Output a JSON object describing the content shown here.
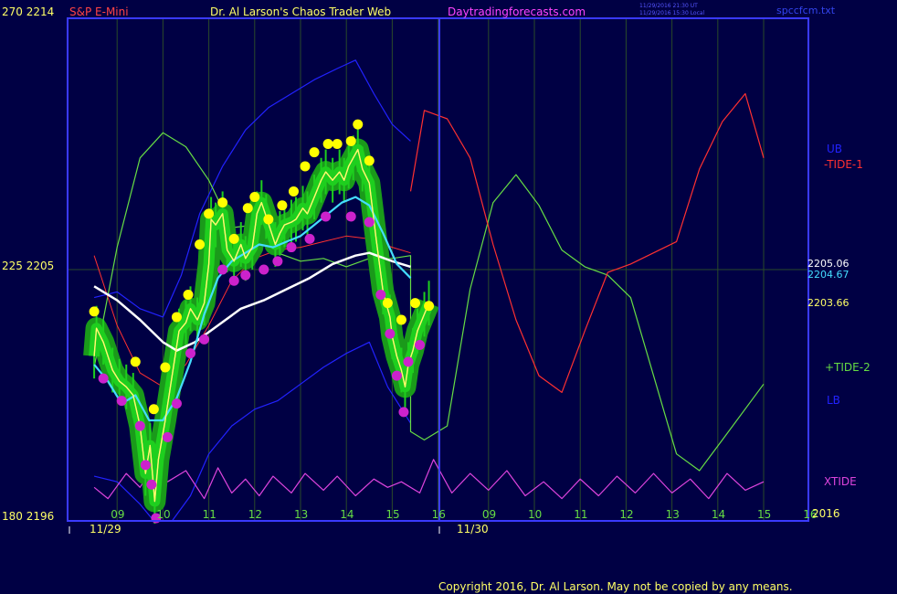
{
  "header": {
    "symbol": "S&P E-Mini",
    "title": "Dr. Al Larson's Chaos Trader Web",
    "site": "Daytradingforecasts.com",
    "timestamp_utc": "11/29/2016 21:30 UT",
    "timestamp_local": "11/29/2016 15:30 Local",
    "filename": "spccfcm.txt"
  },
  "axis": {
    "left_top": "270  2214",
    "left_mid": "225  2205",
    "left_bottom": "180  2196",
    "date1": "11/29",
    "date2": "11/30",
    "year": "2016",
    "hour_ticks": [
      "09",
      "10",
      "11",
      "12",
      "13",
      "14",
      "15",
      "16",
      "09",
      "10",
      "11",
      "12",
      "13",
      "14",
      "15",
      "16"
    ]
  },
  "price_labels": {
    "p1": "2205.06",
    "p2": "2204.67",
    "p3": "2203.66"
  },
  "legend": {
    "ub": "UB",
    "tide1": "-TIDE-1",
    "tide2": "+TIDE-2",
    "lb": "LB",
    "xtide": "XTIDE"
  },
  "copyright": "Copyright 2016, Dr. Al Larson. May not be copied by any means.",
  "colors": {
    "background": "#000044",
    "frame": "#3a3aff",
    "grid": "#2a4a2a",
    "tick_text": "#ffff66",
    "symbol": "#ff4444",
    "title": "#ffff66",
    "site": "#ff44ff",
    "price_bar": "#1ecf1e",
    "glow": "#1a9a1a",
    "high_dot": "#ffff00",
    "low_dot": "#cc22cc",
    "close_line": "#ffff66",
    "fast_avg": "#ff66ff",
    "cyan_avg": "#44ddff",
    "white_avg": "#ffffff",
    "tide1": "#ff3030",
    "tide2": "#66dd44",
    "bands": "#2222ff",
    "xtide": "#dd44dd"
  },
  "chart_data": {
    "type": "line",
    "title": "Dr. Al Larson's Chaos Trader Web",
    "ylim": [
      2196,
      2214
    ],
    "y_ticks": [
      2196,
      2205,
      2214
    ],
    "x_hours": [
      8.5,
      17.5
    ],
    "price_close": [
      [
        8.5,
        2201.9
      ],
      [
        8.55,
        2202.9
      ],
      [
        8.7,
        2202.4
      ],
      [
        8.9,
        2201.4
      ],
      [
        9.05,
        2201.0
      ],
      [
        9.2,
        2200.8
      ],
      [
        9.35,
        2200.5
      ],
      [
        9.5,
        2199.4
      ],
      [
        9.62,
        2197.7
      ],
      [
        9.72,
        2198.7
      ],
      [
        9.82,
        2196.7
      ],
      [
        9.9,
        2198.2
      ],
      [
        10.05,
        2199.6
      ],
      [
        10.2,
        2201.2
      ],
      [
        10.35,
        2202.8
      ],
      [
        10.5,
        2203.1
      ],
      [
        10.6,
        2203.6
      ],
      [
        10.75,
        2203.2
      ],
      [
        10.9,
        2203.8
      ],
      [
        11.0,
        2205.2
      ],
      [
        11.05,
        2206.8
      ],
      [
        11.15,
        2206.6
      ],
      [
        11.3,
        2207.0
      ],
      [
        11.4,
        2205.7
      ],
      [
        11.55,
        2205.3
      ],
      [
        11.7,
        2205.9
      ],
      [
        11.8,
        2205.4
      ],
      [
        11.95,
        2205.8
      ],
      [
        12.05,
        2207.0
      ],
      [
        12.15,
        2207.4
      ],
      [
        12.25,
        2206.9
      ],
      [
        12.45,
        2205.9
      ],
      [
        12.55,
        2206.3
      ],
      [
        12.65,
        2206.6
      ],
      [
        12.8,
        2206.7
      ],
      [
        12.9,
        2206.8
      ],
      [
        13.05,
        2207.2
      ],
      [
        13.15,
        2207.0
      ],
      [
        13.3,
        2207.6
      ],
      [
        13.45,
        2208.2
      ],
      [
        13.55,
        2208.5
      ],
      [
        13.7,
        2208.2
      ],
      [
        13.85,
        2208.5
      ],
      [
        13.95,
        2208.2
      ],
      [
        14.05,
        2208.7
      ],
      [
        14.15,
        2209.0
      ],
      [
        14.25,
        2209.3
      ],
      [
        14.35,
        2208.6
      ],
      [
        14.5,
        2208.1
      ],
      [
        14.65,
        2206.1
      ],
      [
        14.8,
        2204.2
      ],
      [
        14.95,
        2203.3
      ],
      [
        15.0,
        2202.6
      ],
      [
        15.1,
        2201.9
      ],
      [
        15.2,
        2201.4
      ],
      [
        15.28,
        2200.8
      ],
      [
        15.35,
        2201.6
      ],
      [
        15.45,
        2202.1
      ],
      [
        15.55,
        2202.8
      ],
      [
        15.7,
        2203.4
      ],
      [
        15.8,
        2203.8
      ]
    ],
    "highs": [
      [
        8.5,
        2203.5
      ],
      [
        9.4,
        2201.7
      ],
      [
        9.8,
        2200.0
      ],
      [
        10.05,
        2201.5
      ],
      [
        10.3,
        2203.3
      ],
      [
        10.55,
        2204.1
      ],
      [
        10.8,
        2205.9
      ],
      [
        11.0,
        2207.0
      ],
      [
        11.3,
        2207.4
      ],
      [
        11.55,
        2206.1
      ],
      [
        11.85,
        2207.2
      ],
      [
        12.0,
        2207.6
      ],
      [
        12.3,
        2206.8
      ],
      [
        12.6,
        2207.3
      ],
      [
        12.85,
        2207.8
      ],
      [
        13.1,
        2208.7
      ],
      [
        13.3,
        2209.2
      ],
      [
        13.6,
        2209.5
      ],
      [
        13.8,
        2209.5
      ],
      [
        14.1,
        2209.6
      ],
      [
        14.25,
        2210.2
      ],
      [
        14.5,
        2208.9
      ],
      [
        14.9,
        2203.8
      ],
      [
        15.2,
        2203.2
      ],
      [
        15.5,
        2203.8
      ],
      [
        15.8,
        2203.7
      ]
    ],
    "lows": [
      [
        8.7,
        2201.1
      ],
      [
        9.1,
        2200.3
      ],
      [
        9.5,
        2199.4
      ],
      [
        9.62,
        2198.0
      ],
      [
        9.75,
        2197.3
      ],
      [
        9.85,
        2196.1
      ],
      [
        10.1,
        2199.0
      ],
      [
        10.3,
        2200.2
      ],
      [
        10.6,
        2202.0
      ],
      [
        10.9,
        2202.5
      ],
      [
        11.3,
        2205.0
      ],
      [
        11.55,
        2204.6
      ],
      [
        11.8,
        2204.8
      ],
      [
        12.2,
        2205.0
      ],
      [
        12.5,
        2205.3
      ],
      [
        12.8,
        2205.8
      ],
      [
        13.2,
        2206.1
      ],
      [
        13.55,
        2206.9
      ],
      [
        14.1,
        2206.9
      ],
      [
        14.5,
        2206.7
      ],
      [
        14.75,
        2204.1
      ],
      [
        14.95,
        2202.7
      ],
      [
        15.1,
        2201.2
      ],
      [
        15.25,
        2199.9
      ],
      [
        15.35,
        2201.7
      ],
      [
        15.6,
        2202.3
      ]
    ],
    "series": [
      {
        "name": "UB",
        "values": [
          [
            8.5,
            2204.0
          ],
          [
            9.0,
            2204.2
          ],
          [
            9.5,
            2203.6
          ],
          [
            10.0,
            2203.3
          ],
          [
            10.4,
            2204.8
          ],
          [
            10.8,
            2207.0
          ],
          [
            11.3,
            2208.7
          ],
          [
            11.8,
            2210.0
          ],
          [
            12.3,
            2210.8
          ],
          [
            12.8,
            2211.3
          ],
          [
            13.3,
            2211.8
          ],
          [
            13.8,
            2212.2
          ],
          [
            14.2,
            2212.5
          ],
          [
            14.6,
            2211.3
          ],
          [
            15.0,
            2210.2
          ],
          [
            15.4,
            2209.6
          ]
        ]
      },
      {
        "name": "LB",
        "values": [
          [
            8.5,
            2197.6
          ],
          [
            9.0,
            2197.4
          ],
          [
            9.5,
            2196.6
          ],
          [
            9.8,
            2196.0
          ],
          [
            10.2,
            2196.0
          ],
          [
            10.6,
            2196.9
          ],
          [
            11.0,
            2198.4
          ],
          [
            11.5,
            2199.4
          ],
          [
            12.0,
            2200.0
          ],
          [
            12.5,
            2200.3
          ],
          [
            13.0,
            2200.9
          ],
          [
            13.5,
            2201.5
          ],
          [
            14.0,
            2202.0
          ],
          [
            14.5,
            2202.4
          ],
          [
            14.9,
            2200.8
          ],
          [
            15.4,
            2199.5
          ]
        ]
      },
      {
        "name": "-TIDE-1",
        "values": [
          [
            15.4,
            2207.8
          ],
          [
            15.7,
            2210.7
          ],
          [
            16.2,
            2210.4
          ],
          [
            16.7,
            2209.0
          ],
          [
            17.2,
            2205.9
          ],
          [
            17.7,
            2203.2
          ],
          [
            18.2,
            2201.2
          ],
          [
            18.7,
            2200.6
          ],
          [
            19.2,
            2202.8
          ],
          [
            19.7,
            2204.9
          ],
          [
            20.2,
            2205.2
          ],
          [
            20.7,
            2205.6
          ],
          [
            21.2,
            2206.0
          ],
          [
            21.7,
            2208.6
          ],
          [
            22.2,
            2210.3
          ],
          [
            22.7,
            2211.3
          ],
          [
            23.1,
            2209.0
          ]
        ]
      },
      {
        "name": "+TIDE-2",
        "values": [
          [
            8.5,
            2201.5
          ],
          [
            9.0,
            2205.8
          ],
          [
            9.5,
            2209.0
          ],
          [
            10.0,
            2209.9
          ],
          [
            10.5,
            2209.4
          ],
          [
            11.0,
            2208.2
          ],
          [
            11.5,
            2206.5
          ],
          [
            12.0,
            2206.6
          ],
          [
            12.5,
            2205.6
          ],
          [
            13.0,
            2205.3
          ],
          [
            13.5,
            2205.4
          ],
          [
            14.0,
            2205.1
          ],
          [
            14.5,
            2205.4
          ],
          [
            15.0,
            2205.4
          ],
          [
            15.4,
            2205.5
          ],
          [
            15.4,
            2199.2
          ],
          [
            15.7,
            2198.9
          ],
          [
            16.2,
            2199.4
          ],
          [
            16.7,
            2204.3
          ],
          [
            17.2,
            2207.4
          ],
          [
            17.7,
            2208.4
          ],
          [
            18.2,
            2207.3
          ],
          [
            18.7,
            2205.7
          ],
          [
            19.2,
            2205.1
          ],
          [
            19.7,
            2204.8
          ],
          [
            20.2,
            2204.0
          ],
          [
            20.7,
            2201.2
          ],
          [
            21.2,
            2198.4
          ],
          [
            21.7,
            2197.8
          ],
          [
            22.2,
            2198.9
          ],
          [
            23.1,
            2200.9
          ]
        ]
      },
      {
        "name": "XTIDE",
        "values": [
          [
            8.5,
            2197.2
          ],
          [
            8.8,
            2196.8
          ],
          [
            9.2,
            2197.7
          ],
          [
            9.5,
            2197.2
          ],
          [
            9.8,
            2198.0
          ],
          [
            10.1,
            2197.4
          ],
          [
            10.5,
            2197.8
          ],
          [
            10.9,
            2196.8
          ],
          [
            11.2,
            2197.9
          ],
          [
            11.5,
            2197.0
          ],
          [
            11.8,
            2197.5
          ],
          [
            12.1,
            2196.9
          ],
          [
            12.4,
            2197.6
          ],
          [
            12.8,
            2197.0
          ],
          [
            13.1,
            2197.7
          ],
          [
            13.5,
            2197.1
          ],
          [
            13.8,
            2197.6
          ],
          [
            14.2,
            2196.9
          ],
          [
            14.6,
            2197.5
          ],
          [
            14.9,
            2197.2
          ],
          [
            15.2,
            2197.4
          ],
          [
            15.6,
            2197.0
          ],
          [
            15.9,
            2198.2
          ],
          [
            16.3,
            2197.0
          ],
          [
            16.7,
            2197.7
          ],
          [
            17.1,
            2197.1
          ],
          [
            17.5,
            2197.8
          ],
          [
            17.9,
            2196.9
          ],
          [
            18.3,
            2197.4
          ],
          [
            18.7,
            2196.8
          ],
          [
            19.1,
            2197.5
          ],
          [
            19.5,
            2196.9
          ],
          [
            19.9,
            2197.6
          ],
          [
            20.3,
            2197.0
          ],
          [
            20.7,
            2197.7
          ],
          [
            21.1,
            2197.0
          ],
          [
            21.5,
            2197.5
          ],
          [
            21.9,
            2196.8
          ],
          [
            22.3,
            2197.7
          ],
          [
            22.7,
            2197.1
          ],
          [
            23.1,
            2197.4
          ]
        ]
      },
      {
        "name": "cyan_avg",
        "values": [
          [
            8.5,
            2201.6
          ],
          [
            8.8,
            2201.0
          ],
          [
            9.1,
            2200.2
          ],
          [
            9.4,
            2200.5
          ],
          [
            9.7,
            2199.6
          ],
          [
            10.0,
            2199.6
          ],
          [
            10.3,
            2200.4
          ],
          [
            10.6,
            2201.7
          ],
          [
            10.9,
            2203.4
          ],
          [
            11.2,
            2204.7
          ],
          [
            11.5,
            2205.3
          ],
          [
            11.8,
            2205.6
          ],
          [
            12.1,
            2205.9
          ],
          [
            12.4,
            2205.8
          ],
          [
            12.7,
            2206.0
          ],
          [
            13.0,
            2206.2
          ],
          [
            13.3,
            2206.6
          ],
          [
            13.6,
            2207.0
          ],
          [
            13.9,
            2207.4
          ],
          [
            14.2,
            2207.6
          ],
          [
            14.5,
            2207.3
          ],
          [
            14.8,
            2206.3
          ],
          [
            15.1,
            2205.2
          ],
          [
            15.4,
            2204.7
          ]
        ]
      },
      {
        "name": "white_avg",
        "values": [
          [
            8.5,
            2204.4
          ],
          [
            9.0,
            2203.9
          ],
          [
            9.5,
            2203.2
          ],
          [
            10.0,
            2202.4
          ],
          [
            10.3,
            2202.1
          ],
          [
            10.7,
            2202.4
          ],
          [
            11.2,
            2203.0
          ],
          [
            11.7,
            2203.6
          ],
          [
            12.2,
            2203.9
          ],
          [
            12.7,
            2204.3
          ],
          [
            13.2,
            2204.7
          ],
          [
            13.7,
            2205.2
          ],
          [
            14.2,
            2205.5
          ],
          [
            14.5,
            2205.6
          ],
          [
            15.0,
            2205.3
          ],
          [
            15.4,
            2205.1
          ]
        ]
      },
      {
        "name": "red_avg",
        "values": [
          [
            8.5,
            2205.5
          ],
          [
            9.0,
            2203.0
          ],
          [
            9.5,
            2201.3
          ],
          [
            10.0,
            2200.8
          ],
          [
            10.5,
            2201.6
          ],
          [
            11.0,
            2203.0
          ],
          [
            11.5,
            2204.6
          ],
          [
            12.0,
            2205.4
          ],
          [
            12.5,
            2205.7
          ],
          [
            13.0,
            2205.8
          ],
          [
            13.5,
            2206.0
          ],
          [
            14.0,
            2206.2
          ],
          [
            14.5,
            2206.1
          ],
          [
            15.0,
            2205.8
          ],
          [
            15.4,
            2205.6
          ]
        ]
      }
    ]
  }
}
